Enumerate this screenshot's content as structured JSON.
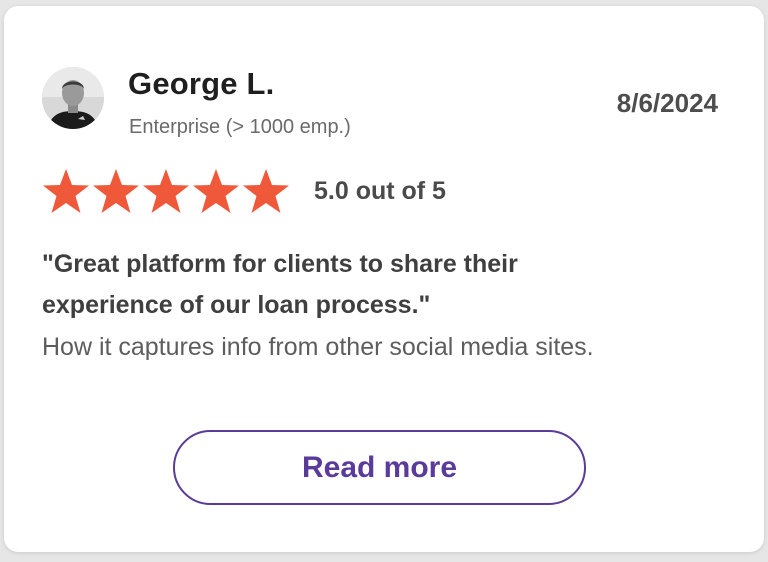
{
  "review": {
    "reviewer_name": "George L.",
    "company_size": "Enterprise (> 1000 emp.)",
    "date": "8/6/2024",
    "rating_value": 5.0,
    "rating_max": 5,
    "rating_text": "5.0 out of 5",
    "headline": "\"Great platform for clients to share their experience of our loan process.\"",
    "body": "How it captures info from other social media sites.",
    "read_more_label": "Read more"
  },
  "colors": {
    "star": "#f0583a",
    "button_accent": "#5a3a9a",
    "card_background": "#ffffff",
    "page_background": "#e6e6e6"
  },
  "icons": {
    "avatar": "user-photo",
    "star": "star-icon"
  }
}
